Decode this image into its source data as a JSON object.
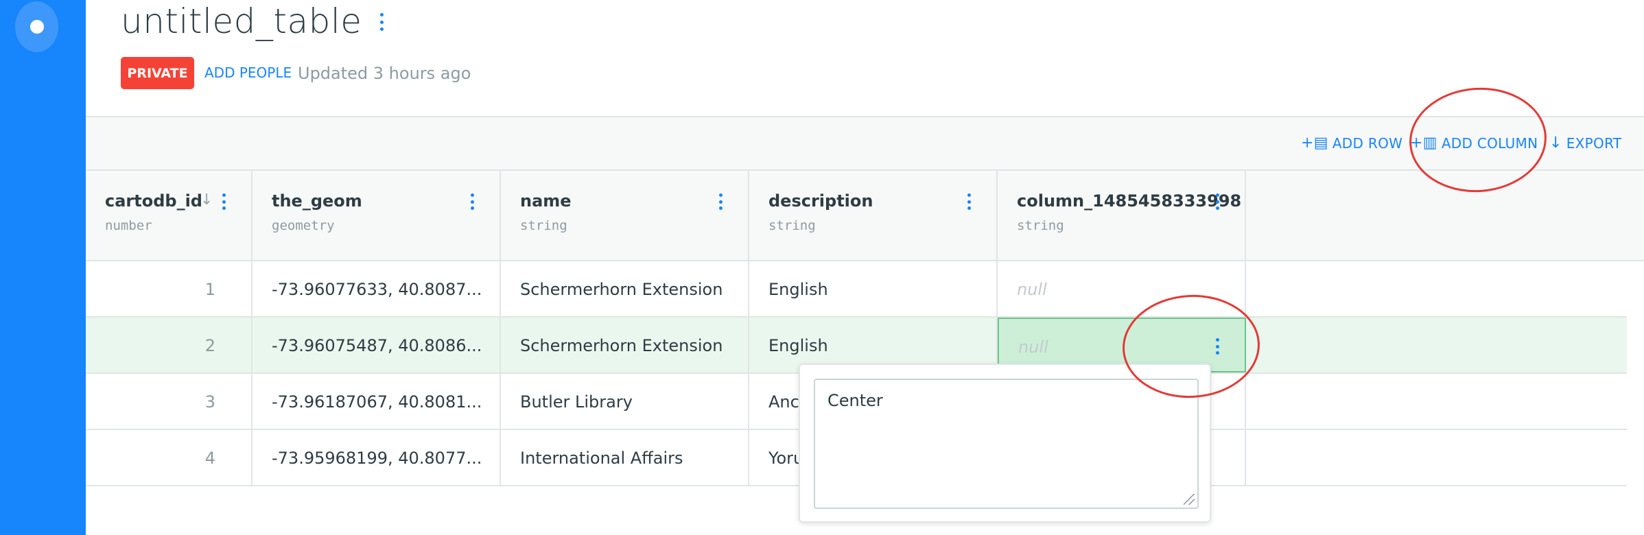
{
  "app": {
    "title": "untitled_table",
    "privacy": "PRIVATE",
    "add_people": "ADD PEOPLE",
    "updated": "Updated 3 hours ago"
  },
  "toolbar": {
    "add_row": "ADD ROW",
    "add_column": "ADD COLUMN",
    "export": "EXPORT"
  },
  "table": {
    "columns": [
      {
        "name": "cartodb_id",
        "type": "number"
      },
      {
        "name": "the_geom",
        "type": "geometry"
      },
      {
        "name": "name",
        "type": "string"
      },
      {
        "name": "description",
        "type": "string"
      },
      {
        "name": "column_1485458333998",
        "type": "string"
      }
    ],
    "rows": [
      {
        "cartodb_id": "1",
        "the_geom": "-73.96077633, 40.8087...",
        "name": "Schermerhorn Extension",
        "description": "English",
        "column_1485458333998": "null"
      },
      {
        "cartodb_id": "2",
        "the_geom": "-73.96075487, 40.8086...",
        "name": "Schermerhorn Extension",
        "description": "English",
        "column_1485458333998": "null"
      },
      {
        "cartodb_id": "3",
        "the_geom": "-73.96187067, 40.8081...",
        "name": "Butler Library",
        "description": "Anc",
        "column_1485458333998": ""
      },
      {
        "cartodb_id": "4",
        "the_geom": "-73.95968199, 40.8077...",
        "name": "International Affairs",
        "description": "Yoru",
        "column_1485458333998": ""
      }
    ],
    "selected_row": 2
  },
  "editor": {
    "value": "Center"
  },
  "colors": {
    "brand_blue": "#1785fb",
    "private_red": "#f44336",
    "selection_green": "#cdefd8",
    "annotation_red": "#e53935"
  },
  "icons": {
    "logo": "carto-logo-icon",
    "menu": "more-vertical-icon",
    "sort": "arrow-down-icon",
    "add_row": "add-row-icon",
    "add_column": "add-column-icon",
    "export": "download-arrow-icon"
  }
}
